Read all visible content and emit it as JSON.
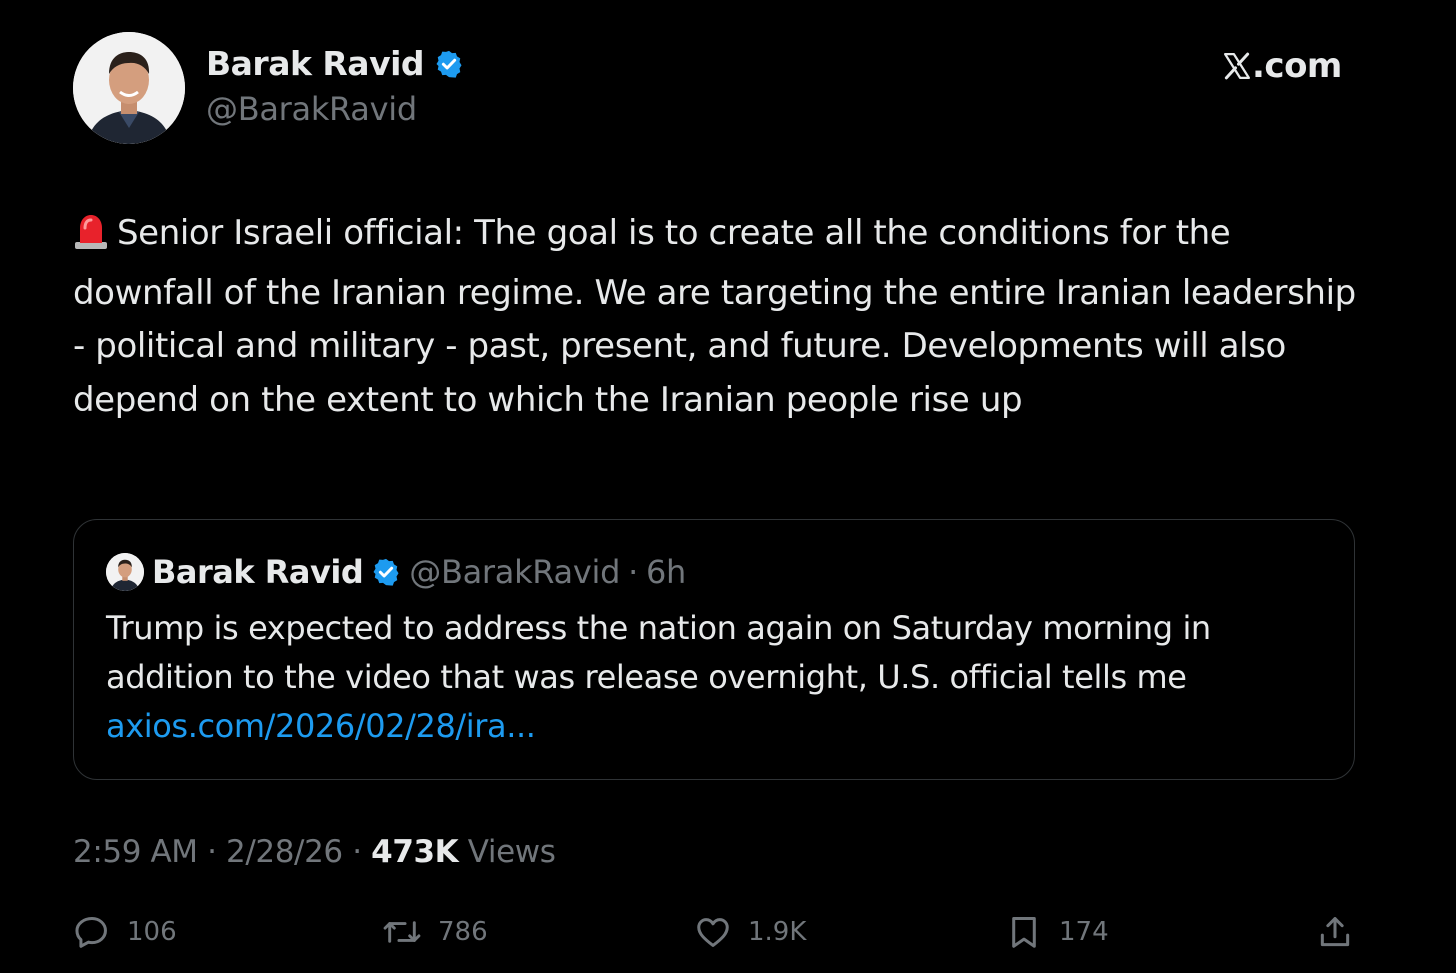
{
  "author": {
    "name": "Barak Ravid",
    "handle": "@BarakRavid",
    "verified_color": "#1d9bf0"
  },
  "brand": {
    "site": ".com",
    "logo_icon": "x-logo-icon"
  },
  "tweet": {
    "siren_icon": "police-light-emoji",
    "text": "Senior Israeli official: The goal is to create all the conditions for the downfall of the Iranian regime. We are targeting the entire Iranian leadership - political and military - past, present, and future. Developments will also depend on the extent to which the Iranian people rise up"
  },
  "quote": {
    "name": "Barak Ravid",
    "handle": "@BarakRavid",
    "separator": "·",
    "time": "6h",
    "text": "Trump is expected to address the nation again on Saturday morning in addition to the video that was release overnight, U.S. official tells me",
    "link": "axios.com/2026/02/28/ira..."
  },
  "meta": {
    "time": "2:59 AM",
    "sep1": "·",
    "date": "2/28/26",
    "sep2": "·",
    "views_count": "473K",
    "views_label": "Views"
  },
  "actions": {
    "replies": "106",
    "reposts": "786",
    "likes": "1.9K",
    "bookmarks": "174"
  },
  "colors": {
    "background": "#000000",
    "text": "#e7e9ea",
    "muted": "#71767b",
    "link": "#1d9bf0",
    "border": "#2f3336"
  }
}
